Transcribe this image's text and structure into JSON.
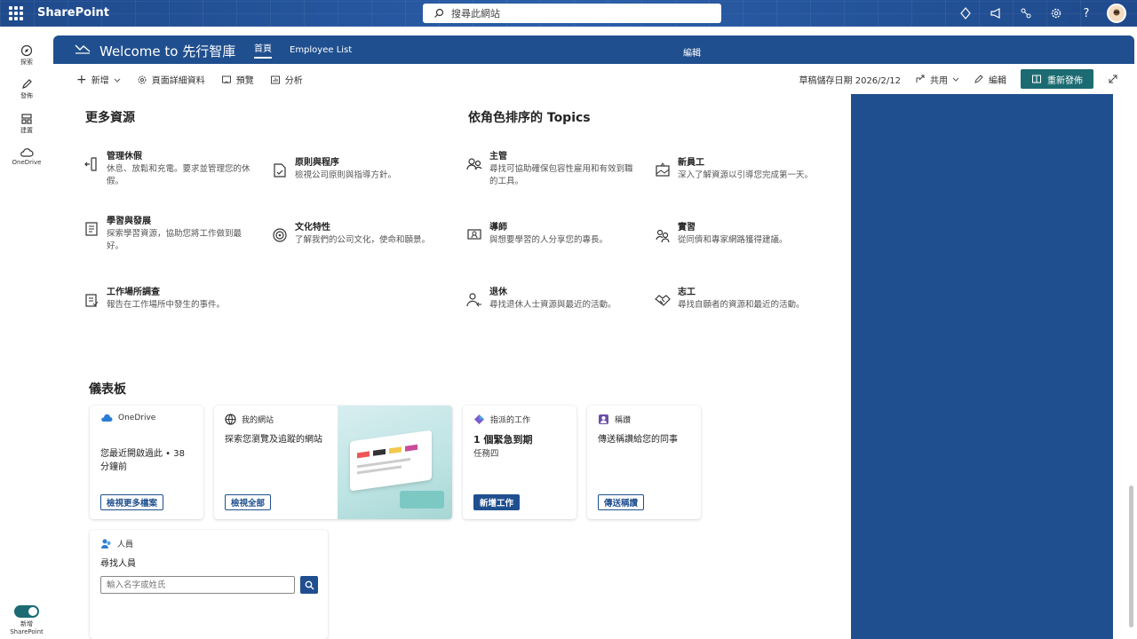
{
  "suite": {
    "title": "SharePoint",
    "search_placeholder": "搜尋此網站"
  },
  "appbar": {
    "search": "探索",
    "post": "發佈",
    "create": "建置",
    "onedrive": "OneDrive",
    "toggle_label_1": "新增",
    "toggle_label_2": "SharePoint"
  },
  "site": {
    "title": "Welcome to 先行智庫",
    "nav": [
      "首頁",
      "Employee List"
    ],
    "edit": "編輯"
  },
  "cmdbar": {
    "new": "新增",
    "details": "頁面詳細資料",
    "preview": "預覽",
    "analytics": "分析",
    "draft": "草稿儲存日期 2026/2/12",
    "share": "共用",
    "edit": "編輯",
    "republish": "重新發佈"
  },
  "resources": {
    "heading": "更多資源",
    "items": [
      {
        "title": "管理休假",
        "desc": "休息、放鬆和充電。要求並管理您的休假。"
      },
      {
        "title": "原則與程序",
        "desc": "檢視公司原則與指導方針。"
      },
      {
        "title": "學習與發展",
        "desc": "探索學習資源，協助您將工作做到最好。"
      },
      {
        "title": "文化特性",
        "desc": "了解我們的公司文化，使命和願景。"
      },
      {
        "title": "工作場所調查",
        "desc": "報告在工作場所中發生的事件。"
      }
    ]
  },
  "topics": {
    "heading": "依角色排序的 Topics",
    "items": [
      {
        "title": "主管",
        "desc": "尋找可協助確保包容性雇用和有效到職的工具。"
      },
      {
        "title": "新員工",
        "desc": "深入了解資源以引導您完成第一天。"
      },
      {
        "title": "導師",
        "desc": "與想要學習的人分享您的專長。"
      },
      {
        "title": "實習",
        "desc": "從同儕和專家網路獲得建議。"
      },
      {
        "title": "退休",
        "desc": "尋找退休人士資源與最近的活動。"
      },
      {
        "title": "志工",
        "desc": "尋找自願者的資源和最近的活動。"
      }
    ]
  },
  "dashboard": {
    "heading": "儀表板",
    "onedrive": {
      "title": "OneDrive",
      "body": "您最近開啟過此 • 38 分鐘前",
      "button": "檢視更多檔案"
    },
    "sites": {
      "title": "我的網站",
      "body": "探索您瀏覽及追蹤的網站",
      "button": "檢視全部"
    },
    "tasks": {
      "title": "指派的工作",
      "body": "1 個緊急到期",
      "sub": "任務四",
      "button": "新增工作"
    },
    "kudos": {
      "title": "稱讚",
      "body": "傳送稱讚給您的同事",
      "button": "傳送稱讚"
    },
    "people": {
      "title": "人員",
      "body": "尋找人員",
      "placeholder": "輸入名字或姓氏"
    }
  },
  "colors": {
    "brand": "#1f4f8f",
    "accent": "#1c6b72"
  }
}
